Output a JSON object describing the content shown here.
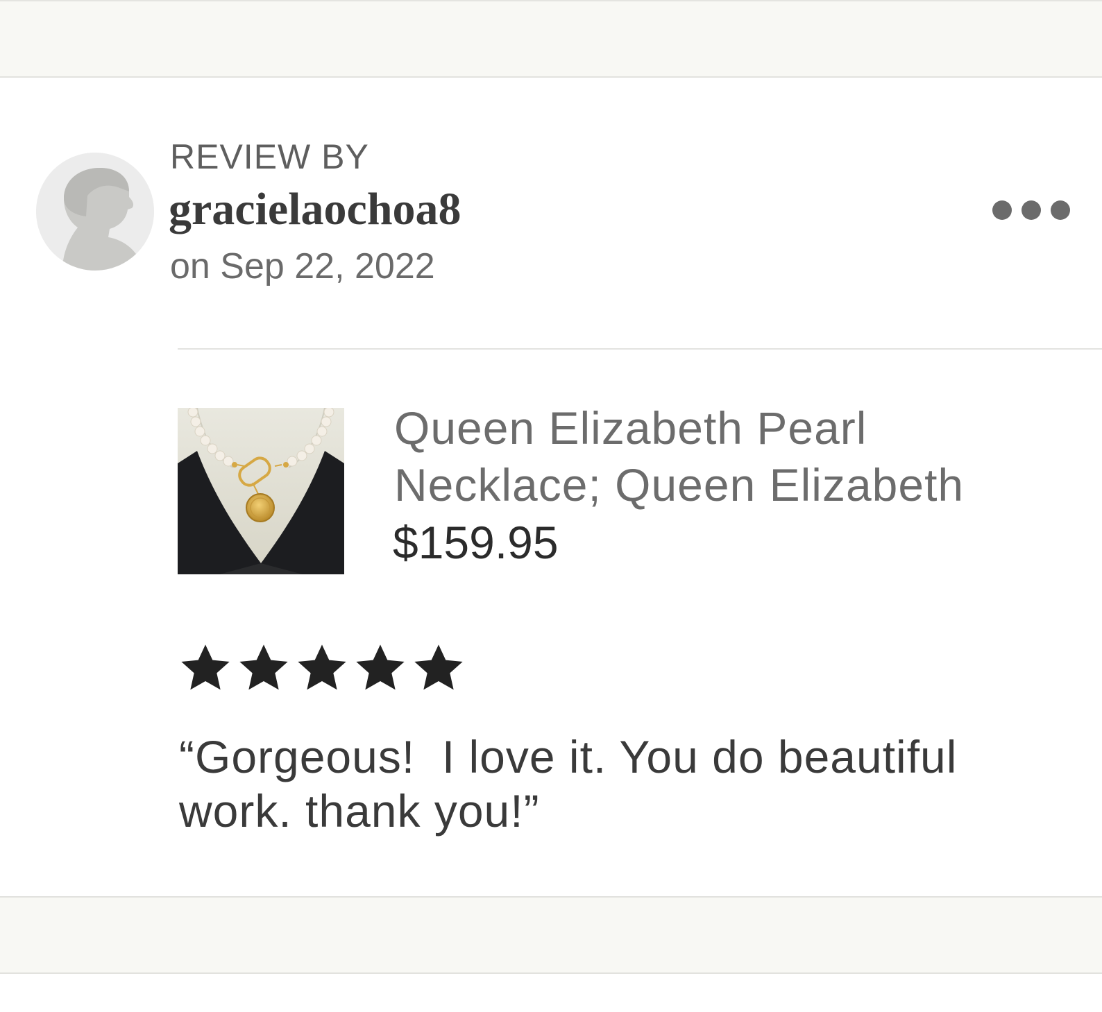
{
  "review": {
    "header_label": "REVIEW BY",
    "reviewer_name": "gracielaochoa8",
    "date": "on Sep 22, 2022",
    "more_icon": "ellipsis-icon"
  },
  "product": {
    "title": "Queen Elizabeth Pearl Necklace; Queen Elizabeth",
    "price": "$159.95",
    "image_alt": "Pearl necklace with gold coin pendant on mannequin"
  },
  "rating": {
    "value": 5,
    "max": 5,
    "icon": "star-icon"
  },
  "review_text": "“Gorgeous!  I love it. You do beautiful work. thank you!”",
  "colors": {
    "band_background": "#f8f8f4",
    "star": "#222222",
    "price": "#2b2b2b",
    "muted_text": "#6c6c6c"
  }
}
